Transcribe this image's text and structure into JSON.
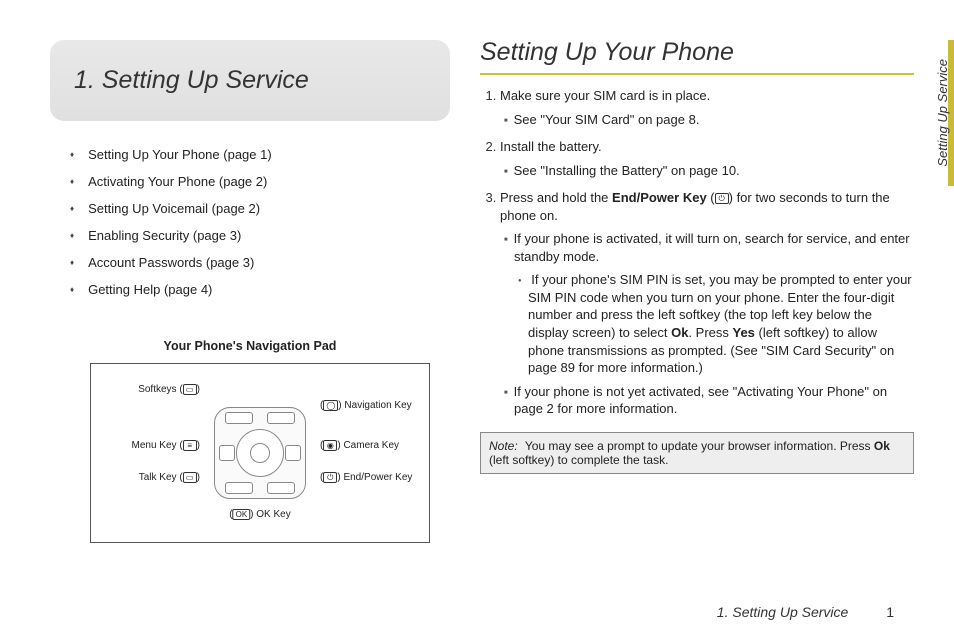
{
  "sidetab": "Setting Up Service",
  "left": {
    "chapter_title": "1.  Setting Up Service",
    "toc": [
      "Setting Up Your Phone (page 1)",
      "Activating Your Phone (page 2)",
      "Setting Up Voicemail (page 2)",
      "Enabling Security (page 3)",
      "Account Passwords (page 3)",
      "Getting Help (page 4)"
    ],
    "diagram_title": "Your Phone's Navigation Pad",
    "labels": {
      "softkeys": "Softkeys (",
      "softkeys_end": ")",
      "menu": "Menu Key (",
      "menu_end": ")",
      "talk": "Talk Key (",
      "talk_end": ")",
      "nav": ") Navigation Key",
      "nav_pre": "(",
      "cam": ") Camera Key",
      "cam_pre": "(",
      "end": ") End/Power Key",
      "end_pre": "(",
      "ok": ") OK Key",
      "ok_pre": "("
    }
  },
  "right": {
    "title": "Setting Up Your Phone",
    "step1": "Make sure your SIM card is in place.",
    "step1a": "See \"Your SIM Card\" on page 8.",
    "step2": "Install the battery.",
    "step2a": "See \"Installing the Battery\" on page 10.",
    "step3_part1": "Press and hold the ",
    "step3_bold": "End/Power Key",
    "step3_part2": " (",
    "step3_part3": ") for two seconds to turn the phone on.",
    "step3a": "If your phone is activated, it will turn on, search for service, and enter standby mode.",
    "step3b_1": "If your phone's SIM PIN is set, you may be prompted to enter your SIM PIN code when you turn on your phone. Enter the four-digit number and press the left softkey (the top left key below the display screen) to select ",
    "step3b_ok": "Ok",
    "step3b_2": ". Press ",
    "step3b_yes": "Yes",
    "step3b_3": " (left softkey) to allow phone transmissions as prompted. (See \"SIM Card Security\" on page 89 for more information.)",
    "step3c": "If your phone is not yet activated, see \"Activating Your Phone\" on page 2 for more information.",
    "note_label": "Note:",
    "note_1": "You may see a prompt to update your browser information. Press ",
    "note_ok": "Ok",
    "note_2": " (left softkey) to complete the task."
  },
  "footer": {
    "text": "1. Setting Up Service",
    "page": "1"
  }
}
